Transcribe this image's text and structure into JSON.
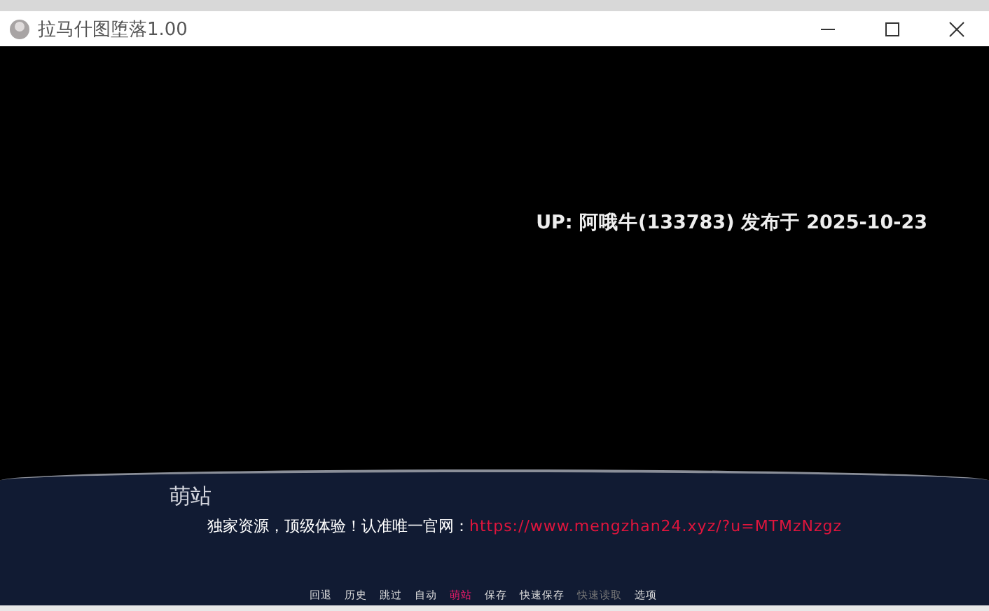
{
  "window": {
    "title": "拉马什图堕落1.00"
  },
  "scene": {
    "caption": "UP: 阿哦牛(133783) 发布于 2025-10-23"
  },
  "dialogue": {
    "speaker": "萌站",
    "text": "独家资源，顶级体验！认准唯一官网：",
    "link": "https://www.mengzhan24.xyz/?u=MTMzNzgz"
  },
  "quick_menu": [
    {
      "label": "回退",
      "selected": false,
      "disabled": false
    },
    {
      "label": "历史",
      "selected": false,
      "disabled": false
    },
    {
      "label": "跳过",
      "selected": false,
      "disabled": false
    },
    {
      "label": "自动",
      "selected": false,
      "disabled": false
    },
    {
      "label": "萌站",
      "selected": true,
      "disabled": false
    },
    {
      "label": "保存",
      "selected": false,
      "disabled": false
    },
    {
      "label": "快速保存",
      "selected": false,
      "disabled": false
    },
    {
      "label": "快速读取",
      "selected": false,
      "disabled": true
    },
    {
      "label": "选项",
      "selected": false,
      "disabled": false
    }
  ]
}
